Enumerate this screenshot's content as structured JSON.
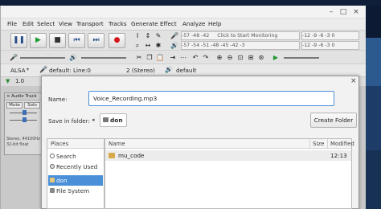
{
  "menu": [
    "File",
    "Edit",
    "Select",
    "View",
    "Transport",
    "Tracks",
    "Generate",
    "Effect",
    "Analyze",
    "Help"
  ],
  "window": {
    "close_glyph": "×",
    "max_glyph": "□",
    "min_glyph": "–"
  },
  "meter": {
    "record_hint": "Click to Start Monitoring",
    "scale_a": "-57 -48 -42",
    "scale_b": "-12 -9 -6 -3 0",
    "scale_c": "-57 -54 -51 -48 -45 -42 -3",
    "scale_d": "-12 -9 -6 -3 0"
  },
  "devices": {
    "host": "ALSA",
    "recording_device": "default: Line:0",
    "channels": "2 (Stereo)",
    "playback_device": "default"
  },
  "ruler": {
    "start": "1.0"
  },
  "track": {
    "name": "Audio Track",
    "mute": "Mute",
    "solo": "Solo",
    "info": "Stereo, 44100Hz\n32-bit float"
  },
  "dialog": {
    "name_label": "Name:",
    "filename": "Voice_Recording.mp3",
    "folder_label": "Save in folder:",
    "current_folder": "don",
    "create_folder": "Create Folder",
    "places_header": "Places",
    "places": [
      {
        "label": "Search",
        "icon": "search-icon"
      },
      {
        "label": "Recently Used",
        "icon": "clock-icon"
      },
      {
        "label": "don",
        "icon": "home-folder-icon",
        "selected": true
      },
      {
        "label": "File System",
        "icon": "drive-icon"
      }
    ],
    "columns": {
      "name": "Name",
      "size": "Size",
      "modified": "Modified"
    },
    "files": [
      {
        "name": "mu_code",
        "size": "",
        "modified": "12:13"
      }
    ],
    "close_glyph": "×"
  }
}
